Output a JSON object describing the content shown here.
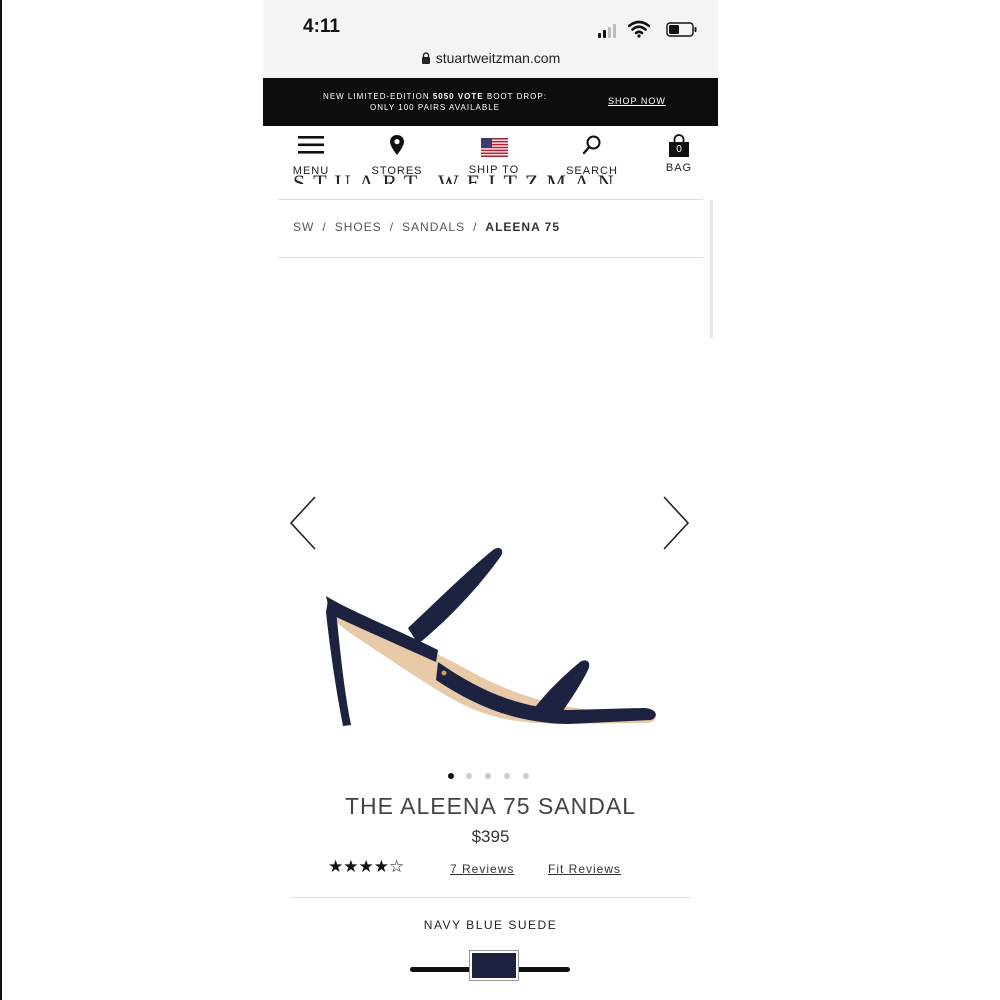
{
  "status_bar": {
    "time": "4:11",
    "url": "stuartweitzman.com"
  },
  "promo": {
    "line1_prefix": "NEW LIMITED-EDITION ",
    "line1_bold": "5050 VOTE",
    "line1_suffix": " BOOT DROP:",
    "line2": "ONLY 100 PAIRS AVAILABLE",
    "link": "SHOP NOW"
  },
  "nav": {
    "menu": "MENU",
    "stores": "STORES",
    "ship_to": "SHIP TO",
    "search": "SEARCH",
    "bag": "BAG",
    "bag_count": "0"
  },
  "breadcrumb": {
    "items": [
      "SW",
      "SHOES",
      "SANDALS"
    ],
    "current": "ALEENA 75",
    "separator": "/"
  },
  "product": {
    "title": "THE ALEENA 75 SANDAL",
    "price": "$395",
    "rating_stars": "★★★★☆",
    "rating_value": 4,
    "rating_max": 5,
    "reviews_link": "7 Reviews",
    "fit_reviews_link": "Fit Reviews",
    "color_name": "NAVY BLUE SUEDE",
    "image_count": 5,
    "active_image": 1
  },
  "colors": {
    "promo_bg": "#0d0d0d",
    "shoe_navy": "#1c2240",
    "shoe_lining": "#e8c9a8"
  }
}
